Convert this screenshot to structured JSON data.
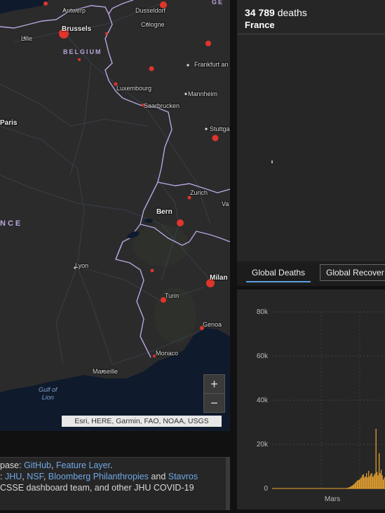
{
  "map": {
    "cities": {
      "antwerp": "Antwerp",
      "dusseldorf": "Dusseldorf",
      "brussels": "Brussels",
      "cologne": "Cologne",
      "lille": "Lille",
      "frankfurt": "Frankfurt an",
      "luxembourg": "Luxembourg",
      "mannheim": "Mannheim",
      "saarbrucken": "Saarbrucken",
      "paris": "Paris",
      "stuttgart": "Stuttga",
      "zurich": "Zurich",
      "vaduz": "Va",
      "bern": "Bern",
      "lyon": "Lyon",
      "milan": "Milan",
      "turin": "Turin",
      "genoa": "Genoa",
      "monaco": "Monaco",
      "marseille": "Marseille"
    },
    "countries": {
      "belgium": "BELGIUM",
      "france": "NCE",
      "germany": "GE"
    },
    "sea": "Gulf of\nLion",
    "zoom_in": "+",
    "zoom_out": "−",
    "attribution": "Esri, HERE, Garmin, FAO, NOAA, USGS"
  },
  "info": {
    "line1_prefix": "pase: ",
    "github": "GitHub",
    "comma": ", ",
    "feature_layer": "Feature Layer",
    "dot": ".",
    "line2_prefix": ": ",
    "jhu": "JHU",
    "nsf": "NSF",
    "bloomberg": "Bloomberg Philanthropies",
    "and": " and ",
    "stavros": "Stavros",
    "line3": "CSSE dashboard team, and other JHU COVID-19"
  },
  "deaths_panel": {
    "count": "34 789",
    "count_suffix": " deaths",
    "location": "France"
  },
  "tabs": {
    "active": "Global Deaths",
    "inactive": "Global Recover"
  },
  "chart_data": {
    "type": "bar",
    "yticks": [
      "80k",
      "60k",
      "40k",
      "20k",
      "0"
    ],
    "ylim": [
      0,
      80000
    ],
    "xtick_label": "Mars",
    "bar_color": "#f0a830",
    "values": [
      0,
      0,
      0,
      0,
      0,
      0,
      0,
      0,
      0,
      0,
      0,
      0,
      0,
      0,
      0,
      0,
      0,
      0,
      0,
      0,
      0,
      0,
      0,
      0,
      0,
      0,
      0,
      0,
      0,
      0,
      0,
      0,
      0,
      0,
      0,
      0,
      0,
      0,
      0,
      0,
      0,
      0,
      0,
      0,
      0,
      0,
      0,
      0,
      0,
      0,
      0,
      0,
      0,
      0,
      0,
      0,
      0,
      0,
      0,
      0,
      0,
      0,
      0,
      0,
      0,
      0,
      0,
      0,
      0,
      0,
      0,
      0,
      300,
      500,
      700,
      900,
      1300,
      1600,
      2000,
      2500,
      3000,
      3500,
      3800,
      4000,
      4500,
      5000,
      6000,
      6500,
      5000,
      5500,
      7000,
      5000,
      8000,
      5500,
      6500,
      7000,
      5200,
      6000,
      6800,
      27000,
      7500,
      6000,
      16000,
      7000,
      8500,
      6000,
      4000,
      5000
    ]
  }
}
